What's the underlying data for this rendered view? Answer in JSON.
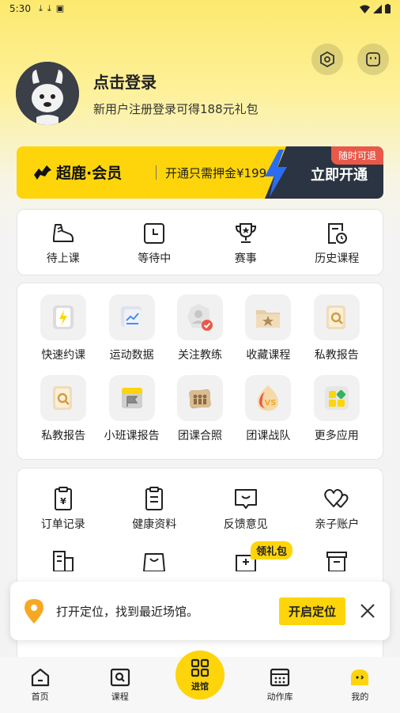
{
  "status_bar": {
    "time": "5:30"
  },
  "profile": {
    "name": "点击登录",
    "subtitle": "新用户注册登录可得188元礼包"
  },
  "vip": {
    "brand": "超鹿·会员",
    "desc": "开通只需押金¥199",
    "cta": "立即开通",
    "badge": "随时可退"
  },
  "course_status": [
    {
      "label": "待上课",
      "icon": "sneaker-icon"
    },
    {
      "label": "等待中",
      "icon": "clock-icon"
    },
    {
      "label": "赛事",
      "icon": "trophy-icon"
    },
    {
      "label": "历史课程",
      "icon": "history-icon"
    }
  ],
  "apps": [
    {
      "label": "快速约课",
      "icon": "lightning-icon"
    },
    {
      "label": "运动数据",
      "icon": "chart-icon"
    },
    {
      "label": "关注教练",
      "icon": "coach-icon"
    },
    {
      "label": "收藏课程",
      "icon": "star-folder-icon"
    },
    {
      "label": "私教报告",
      "icon": "report-icon"
    },
    {
      "label": "私教报告",
      "icon": "report-icon"
    },
    {
      "label": "小班课报告",
      "icon": "flag-report-icon"
    },
    {
      "label": "团课合照",
      "icon": "group-photo-icon"
    },
    {
      "label": "团课战队",
      "icon": "vs-icon"
    },
    {
      "label": "更多应用",
      "icon": "more-apps-icon"
    }
  ],
  "services": [
    {
      "label": "订单记录",
      "icon": "order-icon"
    },
    {
      "label": "健康资料",
      "icon": "clipboard-icon"
    },
    {
      "label": "反馈意见",
      "icon": "feedback-icon"
    },
    {
      "label": "亲子账户",
      "icon": "hearts-icon"
    }
  ],
  "gift_badge": "领礼包",
  "toast": {
    "text": "打开定位，找到最近场馆。",
    "button": "开启定位"
  },
  "nav": [
    {
      "label": "首页",
      "icon": "home-icon"
    },
    {
      "label": "课程",
      "icon": "course-icon"
    },
    {
      "label": "进馆",
      "icon": "qr-icon"
    },
    {
      "label": "动作库",
      "icon": "calendar-icon"
    },
    {
      "label": "我的",
      "icon": "me-icon"
    }
  ],
  "colors": {
    "brand_yellow": "#fdd50a",
    "dark": "#2a3442",
    "badge_red": "#e8594a"
  }
}
